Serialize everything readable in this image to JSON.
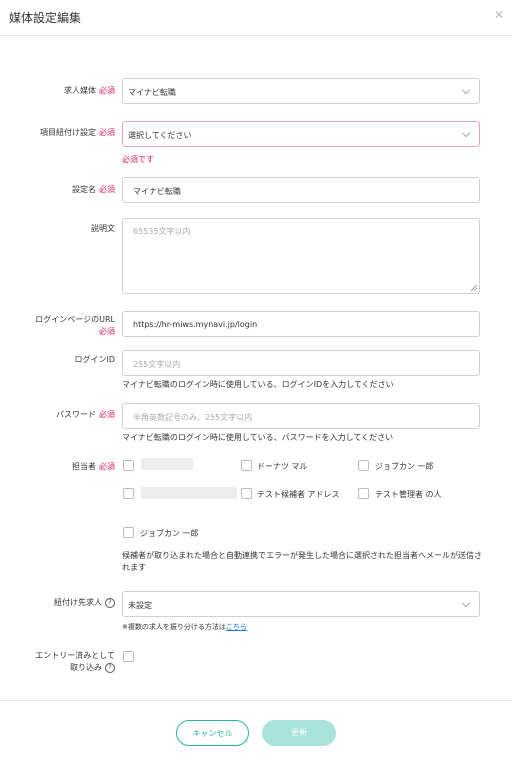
{
  "title": "媒体設定編集",
  "required_mark": "必須",
  "media": {
    "label": "求人媒体",
    "value": "マイナビ転職"
  },
  "mapping": {
    "label": "項目紐付け設定",
    "value": "選択してください",
    "error": "必須です"
  },
  "setting_name": {
    "label": "設定名",
    "value": "マイナビ転職"
  },
  "description": {
    "label": "説明文",
    "placeholder": "65535文字以内"
  },
  "login_url": {
    "label": "ログインページのURL",
    "value": "https://hr-miws.mynavi.jp/login"
  },
  "login_id": {
    "label": "ログインID",
    "placeholder": "255文字以内",
    "hint": "マイナビ転職のログイン時に使用している、ログインIDを入力してください"
  },
  "password": {
    "label": "パスワード",
    "placeholder": "半角英数記号のみ、255文字以内",
    "hint": "マイナビ転職のログイン時に使用している、パスワードを入力してください"
  },
  "assignee": {
    "label": "担当者",
    "options": [
      "ドーナツ マル",
      "ジョブカン 一郎",
      "テスト候補者 アドレス",
      "テスト管理者 の人",
      "ジョブカン 一郎"
    ],
    "note": "候補者が取り込まれた場合と自動連携でエラーが発生した場合に選択された担当者へメールが送信されます"
  },
  "target_job": {
    "label": "紐付け先求人",
    "value": "未設定",
    "note_prefix": "※複数の求人を振り分ける方法は",
    "note_link": "こちら"
  },
  "entry_import": {
    "label_line1": "エントリー済みとして",
    "label_line2": "取り込み"
  },
  "buttons": {
    "cancel": "キャンセル",
    "update": "更新"
  },
  "icons": {
    "close": "close-icon",
    "chevron": "chevron-down-icon",
    "help": "help-icon"
  },
  "colors": {
    "accent": "#2bb3a4",
    "accent_light": "#a8e3db",
    "required": "#e0245e",
    "link": "#1a73e8"
  }
}
